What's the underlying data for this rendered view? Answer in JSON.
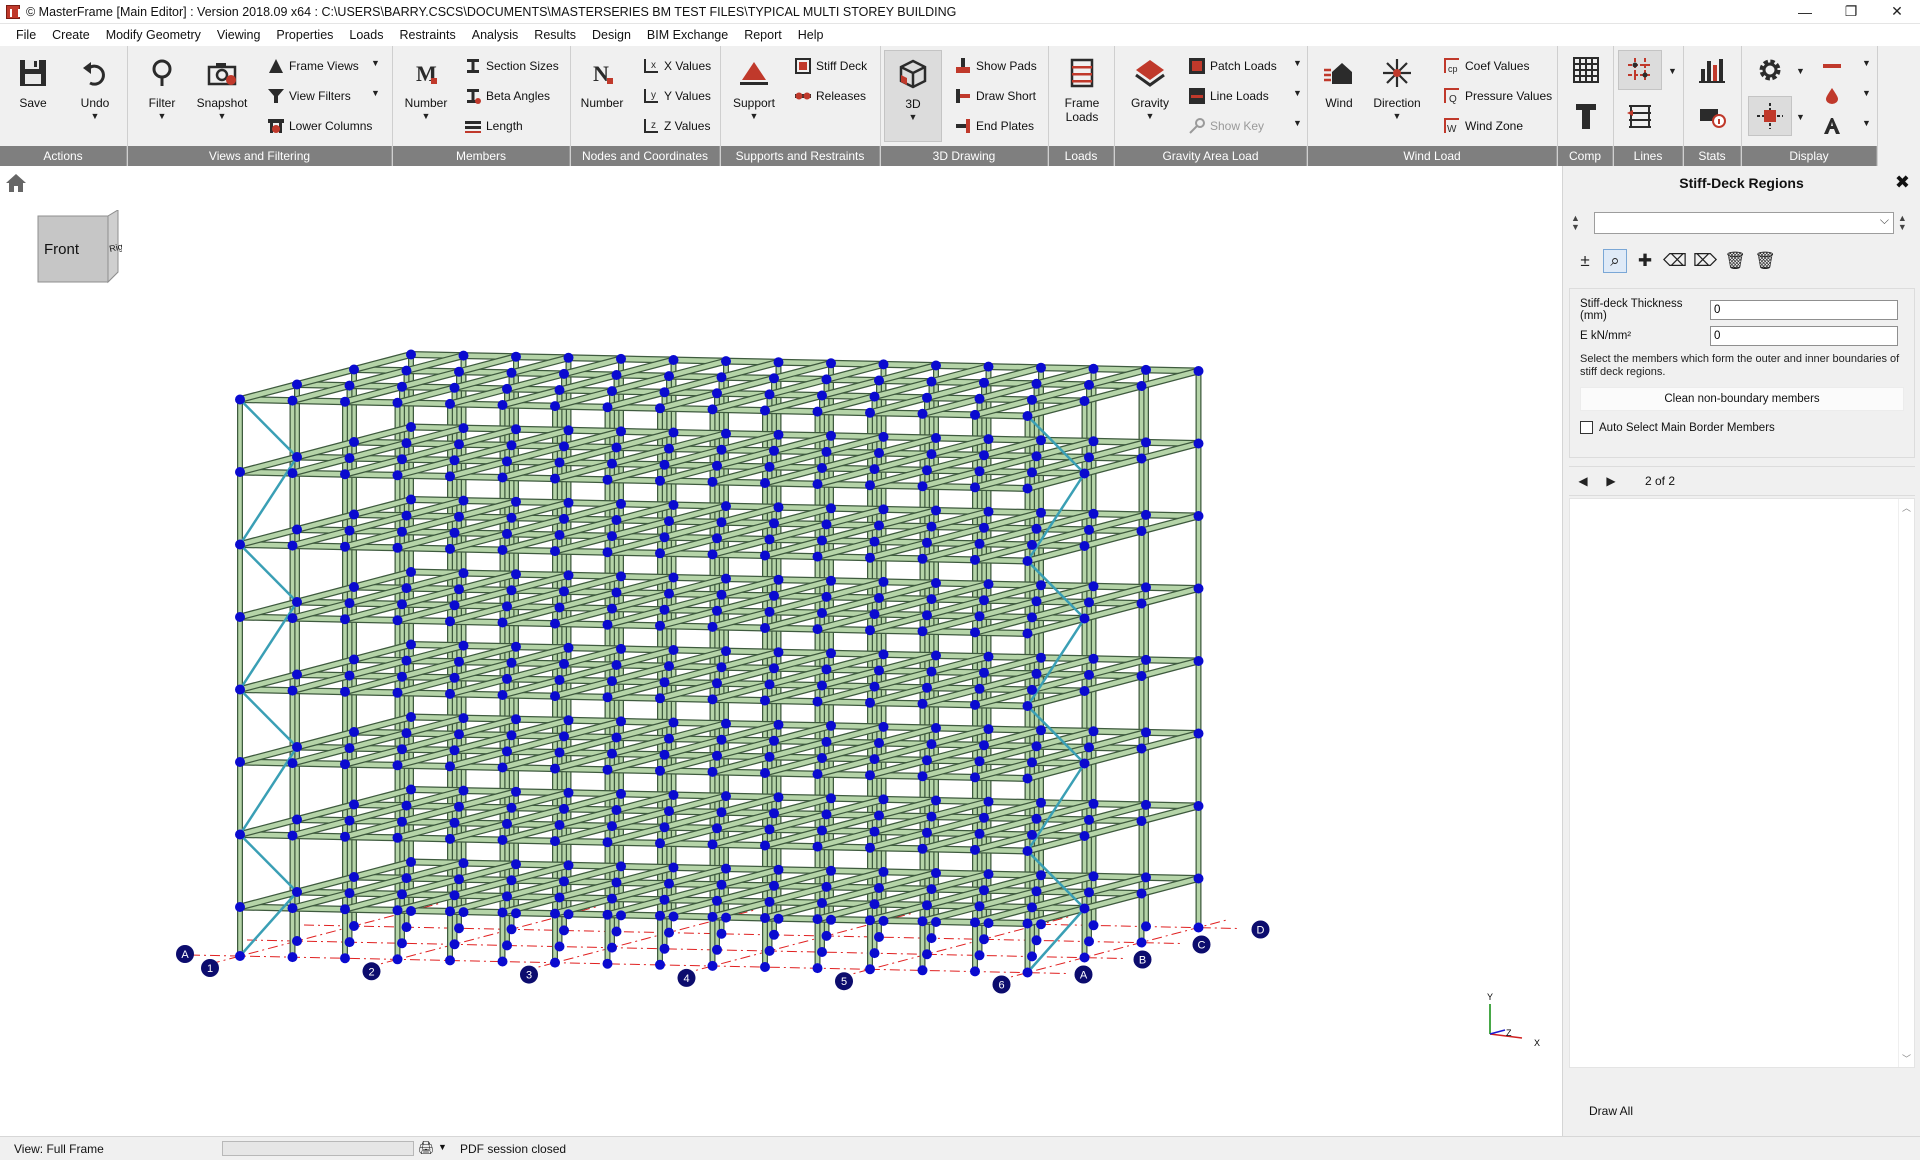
{
  "window": {
    "title": "© MasterFrame [Main Editor] : Version 2018.09 x64 : C:\\USERS\\BARRY.CSCS\\DOCUMENTS\\MASTERSERIES BM TEST FILES\\TYPICAL MULTI STOREY BUILDING",
    "controls": [
      "—",
      "❐",
      "✕"
    ]
  },
  "menu": [
    "File",
    "Create",
    "Modify Geometry",
    "Viewing",
    "Properties",
    "Loads",
    "Restraints",
    "Analysis",
    "Results",
    "Design",
    "BIM Exchange",
    "Report",
    "Help"
  ],
  "ribbon": {
    "actions": {
      "label": "Actions",
      "save": "Save",
      "undo": "Undo"
    },
    "views": {
      "label": "Views and Filtering",
      "filter": "Filter",
      "snapshot": "Snapshot",
      "frame_views": "Frame Views",
      "view_filters": "View Filters",
      "lower_columns": "Lower Columns"
    },
    "members": {
      "label": "Members",
      "number": "Number",
      "section_sizes": "Section Sizes",
      "beta_angles": "Beta Angles",
      "length": "Length"
    },
    "nodes": {
      "label": "Nodes and Coordinates",
      "number": "Number",
      "x_values": "X Values",
      "y_values": "Y Values",
      "z_values": "Z Values"
    },
    "supports": {
      "label": "Supports and Restraints",
      "support": "Support",
      "stiff_deck": "Stiff Deck",
      "releases": "Releases"
    },
    "drawing": {
      "label": "3D Drawing",
      "btn3d": "3D",
      "show_pads": "Show Pads",
      "draw_short": "Draw Short",
      "end_plates": "End Plates"
    },
    "loads": {
      "label": "Loads",
      "frame_loads": "Frame Loads"
    },
    "gravity": {
      "label": "Gravity Area Load",
      "gravity": "Gravity",
      "patch_loads": "Patch Loads",
      "line_loads": "Line Loads",
      "show_key": "Show Key"
    },
    "wind": {
      "label": "Wind Load",
      "wind": "Wind",
      "direction": "Direction",
      "coef_values": "Coef Values",
      "pressure_values": "Pressure Values",
      "wind_zone": "Wind Zone"
    },
    "comp": {
      "label": "Comp"
    },
    "lines": {
      "label": "Lines"
    },
    "stats": {
      "label": "Stats"
    },
    "display": {
      "label": "Display"
    }
  },
  "viewcube": {
    "front": "Front",
    "right": "Right"
  },
  "model": {
    "gridlines": {
      "numbers": [
        "1",
        "2",
        "3",
        "4",
        "5",
        "6"
      ],
      "letters": [
        "A",
        "B",
        "C",
        "D"
      ]
    },
    "axes": {
      "x": "X",
      "y": "Y",
      "z": "Z"
    },
    "colors": {
      "beam": "#b5d4a8",
      "beam_edge": "#3e5a3e",
      "node": "#0a0ad0",
      "bracing": "#3a9fb5",
      "gridline": "#e02020",
      "label_bubble": "#0c0c6e"
    }
  },
  "panel": {
    "title": "Stiff-Deck Regions",
    "close": "✖",
    "region_select": "",
    "tools": [
      "±",
      "⌕",
      "✚",
      "⌫",
      "⌦",
      "🗑",
      "🗑"
    ],
    "thickness_label": "Stiff-deck Thickness (mm)",
    "thickness_value": "0",
    "e_label": "E kN/mm²",
    "e_value": "0",
    "hint": "Select the members which form the outer and inner boundaries of stiff deck regions.",
    "clean_btn": "Clean non-boundary members",
    "auto_select": "Auto Select Main Border Members",
    "pager": "2 of 2",
    "draw_all": "Draw All"
  },
  "status": {
    "view": "View: Full Frame",
    "pdf": "PDF session closed"
  }
}
